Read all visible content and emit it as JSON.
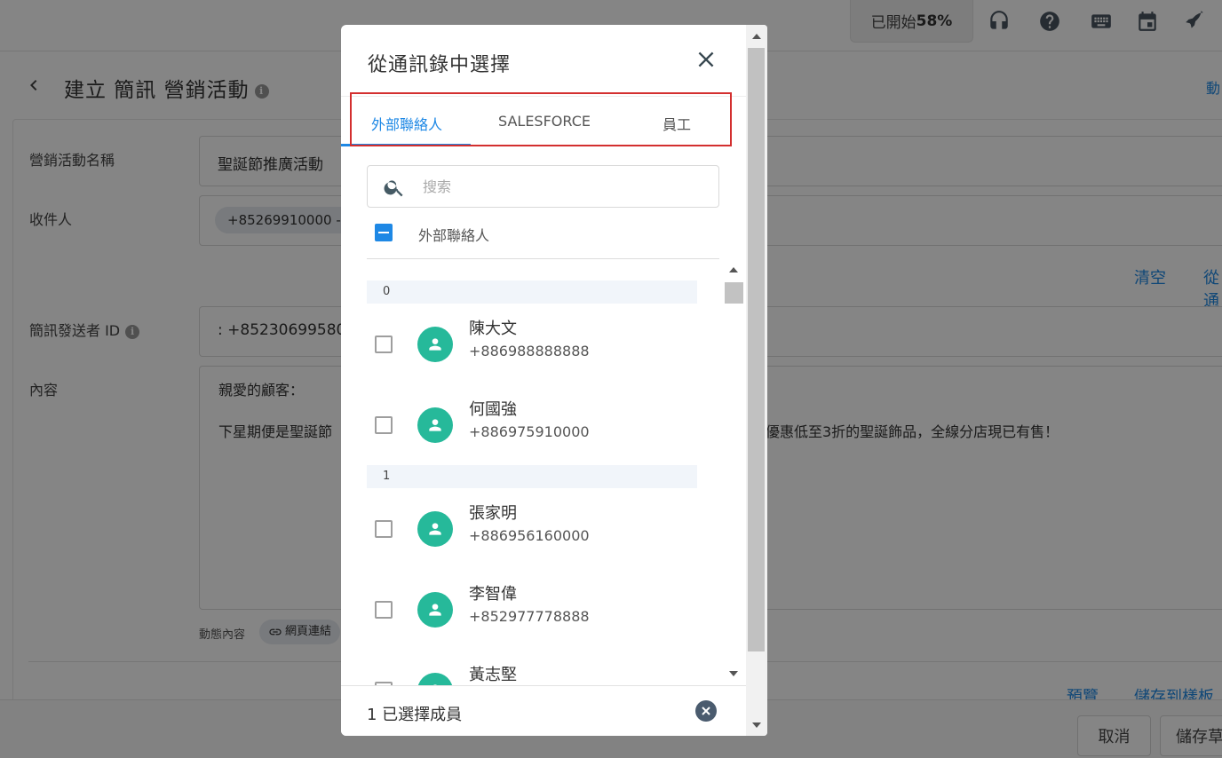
{
  "topbar": {
    "progress_prefix": "已開始",
    "progress_value": "58%",
    "icons": [
      "headset-icon",
      "help-icon",
      "keyboard-icon",
      "calendar-icon",
      "rocket-icon"
    ]
  },
  "page": {
    "title": "建立 簡訊 營銷活動",
    "header_right_text": "動"
  },
  "form": {
    "campaign_name_label": "營銷活動名稱",
    "campaign_name_value": "聖誕節推廣活動",
    "recipients_label": "收件人",
    "recipient_chip": "+85269910000 - +",
    "clear_link": "清空",
    "from_link": "從通",
    "sender_id_label": "簡訊發送者 ID",
    "sender_id_value": ": +85230699580",
    "content_label": "內容",
    "content_line1": "親愛的顧客：",
    "content_line2_left": "下星期便是聖誕節",
    "content_line2_right": "優惠低至3折的聖誕飾品，全線分店現已有售！",
    "dynamic_content_label": "動態內容",
    "web_link_chip": "網頁連結",
    "preview_link": "預覽",
    "save_template_link": "儲存到樣板"
  },
  "footer": {
    "cancel_label": "取消",
    "save_draft_label": "儲存草"
  },
  "modal": {
    "title": "從通訊錄中選擇",
    "tabs": [
      {
        "label": "外部聯絡人",
        "active": true
      },
      {
        "label": "SALESFORCE",
        "active": false
      },
      {
        "label": "員工",
        "active": false
      }
    ],
    "search_placeholder": "搜索",
    "group_label": "外部聯絡人",
    "sections": [
      {
        "header": "0",
        "contacts": [
          {
            "name": "陳大文",
            "phone": "+886988888888"
          },
          {
            "name": "何國強",
            "phone": "+886975910000"
          }
        ]
      },
      {
        "header": "1",
        "contacts": [
          {
            "name": "張家明",
            "phone": "+886956160000"
          },
          {
            "name": "李智偉",
            "phone": "+852977778888"
          },
          {
            "name": "黃志堅",
            "phone": ""
          }
        ]
      }
    ],
    "selected_count_text": "1 已選擇成員"
  },
  "colors": {
    "accent": "#1e88e5",
    "avatar": "#26b99a",
    "highlight_border": "#d32f2f"
  }
}
